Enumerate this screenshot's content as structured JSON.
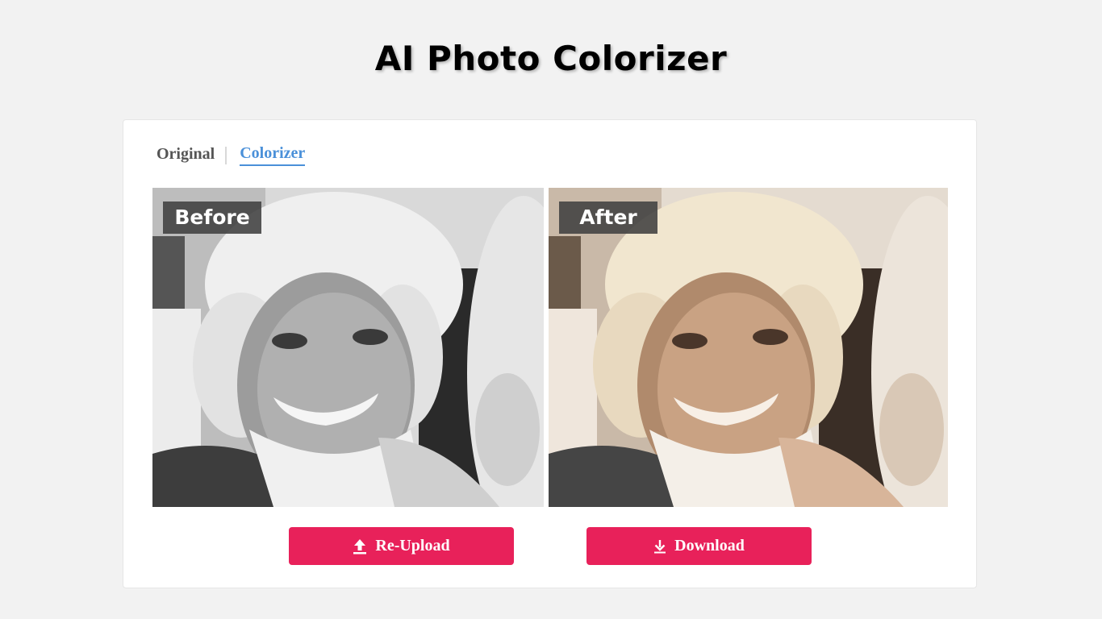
{
  "page": {
    "title": "AI Photo Colorizer",
    "background": "#f2f2f2"
  },
  "tabs": [
    {
      "label": "Original",
      "active": false
    },
    {
      "label": "Colorizer",
      "active": true
    }
  ],
  "colors": {
    "accent": "#4a90d9",
    "button": "#e8215a",
    "label_overlay": "#404040"
  },
  "photos": {
    "before": {
      "label": "Before",
      "tone": "grayscale"
    },
    "after": {
      "label": "After",
      "tone": "colorized"
    }
  },
  "buttons": {
    "reupload": {
      "label": "Re-Upload",
      "icon": "upload-icon"
    },
    "download": {
      "label": "Download",
      "icon": "download-icon"
    }
  }
}
